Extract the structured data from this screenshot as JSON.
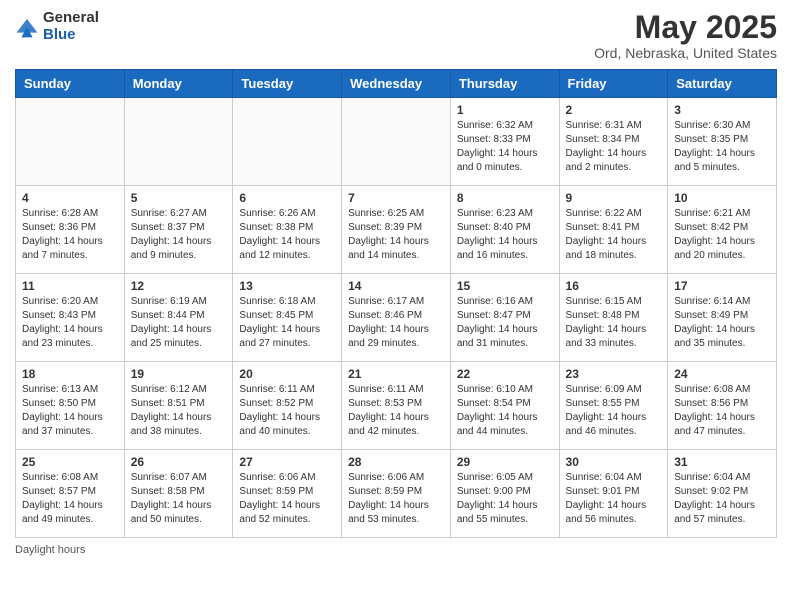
{
  "logo": {
    "general": "General",
    "blue": "Blue"
  },
  "title": "May 2025",
  "subtitle": "Ord, Nebraska, United States",
  "days_of_week": [
    "Sunday",
    "Monday",
    "Tuesday",
    "Wednesday",
    "Thursday",
    "Friday",
    "Saturday"
  ],
  "footer": "Daylight hours",
  "weeks": [
    [
      {
        "day": "",
        "info": ""
      },
      {
        "day": "",
        "info": ""
      },
      {
        "day": "",
        "info": ""
      },
      {
        "day": "",
        "info": ""
      },
      {
        "day": "1",
        "info": "Sunrise: 6:32 AM\nSunset: 8:33 PM\nDaylight: 14 hours and 0 minutes."
      },
      {
        "day": "2",
        "info": "Sunrise: 6:31 AM\nSunset: 8:34 PM\nDaylight: 14 hours and 2 minutes."
      },
      {
        "day": "3",
        "info": "Sunrise: 6:30 AM\nSunset: 8:35 PM\nDaylight: 14 hours and 5 minutes."
      }
    ],
    [
      {
        "day": "4",
        "info": "Sunrise: 6:28 AM\nSunset: 8:36 PM\nDaylight: 14 hours and 7 minutes."
      },
      {
        "day": "5",
        "info": "Sunrise: 6:27 AM\nSunset: 8:37 PM\nDaylight: 14 hours and 9 minutes."
      },
      {
        "day": "6",
        "info": "Sunrise: 6:26 AM\nSunset: 8:38 PM\nDaylight: 14 hours and 12 minutes."
      },
      {
        "day": "7",
        "info": "Sunrise: 6:25 AM\nSunset: 8:39 PM\nDaylight: 14 hours and 14 minutes."
      },
      {
        "day": "8",
        "info": "Sunrise: 6:23 AM\nSunset: 8:40 PM\nDaylight: 14 hours and 16 minutes."
      },
      {
        "day": "9",
        "info": "Sunrise: 6:22 AM\nSunset: 8:41 PM\nDaylight: 14 hours and 18 minutes."
      },
      {
        "day": "10",
        "info": "Sunrise: 6:21 AM\nSunset: 8:42 PM\nDaylight: 14 hours and 20 minutes."
      }
    ],
    [
      {
        "day": "11",
        "info": "Sunrise: 6:20 AM\nSunset: 8:43 PM\nDaylight: 14 hours and 23 minutes."
      },
      {
        "day": "12",
        "info": "Sunrise: 6:19 AM\nSunset: 8:44 PM\nDaylight: 14 hours and 25 minutes."
      },
      {
        "day": "13",
        "info": "Sunrise: 6:18 AM\nSunset: 8:45 PM\nDaylight: 14 hours and 27 minutes."
      },
      {
        "day": "14",
        "info": "Sunrise: 6:17 AM\nSunset: 8:46 PM\nDaylight: 14 hours and 29 minutes."
      },
      {
        "day": "15",
        "info": "Sunrise: 6:16 AM\nSunset: 8:47 PM\nDaylight: 14 hours and 31 minutes."
      },
      {
        "day": "16",
        "info": "Sunrise: 6:15 AM\nSunset: 8:48 PM\nDaylight: 14 hours and 33 minutes."
      },
      {
        "day": "17",
        "info": "Sunrise: 6:14 AM\nSunset: 8:49 PM\nDaylight: 14 hours and 35 minutes."
      }
    ],
    [
      {
        "day": "18",
        "info": "Sunrise: 6:13 AM\nSunset: 8:50 PM\nDaylight: 14 hours and 37 minutes."
      },
      {
        "day": "19",
        "info": "Sunrise: 6:12 AM\nSunset: 8:51 PM\nDaylight: 14 hours and 38 minutes."
      },
      {
        "day": "20",
        "info": "Sunrise: 6:11 AM\nSunset: 8:52 PM\nDaylight: 14 hours and 40 minutes."
      },
      {
        "day": "21",
        "info": "Sunrise: 6:11 AM\nSunset: 8:53 PM\nDaylight: 14 hours and 42 minutes."
      },
      {
        "day": "22",
        "info": "Sunrise: 6:10 AM\nSunset: 8:54 PM\nDaylight: 14 hours and 44 minutes."
      },
      {
        "day": "23",
        "info": "Sunrise: 6:09 AM\nSunset: 8:55 PM\nDaylight: 14 hours and 46 minutes."
      },
      {
        "day": "24",
        "info": "Sunrise: 6:08 AM\nSunset: 8:56 PM\nDaylight: 14 hours and 47 minutes."
      }
    ],
    [
      {
        "day": "25",
        "info": "Sunrise: 6:08 AM\nSunset: 8:57 PM\nDaylight: 14 hours and 49 minutes."
      },
      {
        "day": "26",
        "info": "Sunrise: 6:07 AM\nSunset: 8:58 PM\nDaylight: 14 hours and 50 minutes."
      },
      {
        "day": "27",
        "info": "Sunrise: 6:06 AM\nSunset: 8:59 PM\nDaylight: 14 hours and 52 minutes."
      },
      {
        "day": "28",
        "info": "Sunrise: 6:06 AM\nSunset: 8:59 PM\nDaylight: 14 hours and 53 minutes."
      },
      {
        "day": "29",
        "info": "Sunrise: 6:05 AM\nSunset: 9:00 PM\nDaylight: 14 hours and 55 minutes."
      },
      {
        "day": "30",
        "info": "Sunrise: 6:04 AM\nSunset: 9:01 PM\nDaylight: 14 hours and 56 minutes."
      },
      {
        "day": "31",
        "info": "Sunrise: 6:04 AM\nSunset: 9:02 PM\nDaylight: 14 hours and 57 minutes."
      }
    ]
  ]
}
